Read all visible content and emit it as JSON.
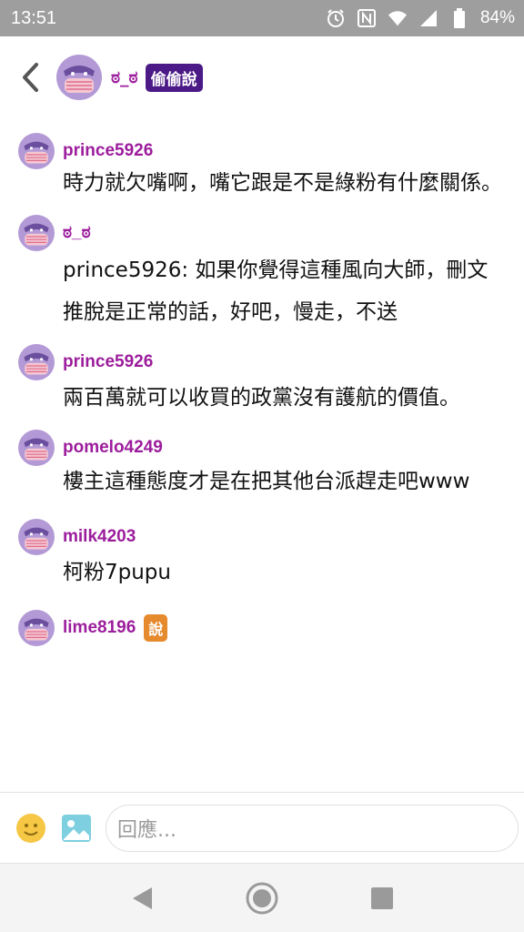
{
  "status_bar": {
    "time": "13:51",
    "battery": "84%",
    "icons": [
      "alarm-icon",
      "nfc-icon",
      "wifi-icon",
      "signal-icon",
      "battery-icon"
    ]
  },
  "header": {
    "title": "ಠ_ಠ",
    "badge": "偷偷說"
  },
  "comments": [
    {
      "user": "prince5926",
      "text": "時力就欠嘴啊，嘴它跟是不是綠粉有什麼關係。"
    },
    {
      "user": "ಠ_ಠ",
      "text": "prince5926: 如果你覺得這種風向大師，刪文推脫是正常的話，好吧，慢走，不送"
    },
    {
      "user": "prince5926",
      "text": "兩百萬就可以收買的政黨沒有護航的價值。"
    },
    {
      "user": "pomelo4249",
      "text": "樓主這種態度才是在把其他台派趕走吧www"
    },
    {
      "user": "milk4203",
      "text": "柯粉7pupu"
    },
    {
      "user": "lime8196",
      "badge": "說",
      "text": ""
    }
  ],
  "reply": {
    "placeholder": "回應..."
  },
  "colors": {
    "username": "#9c1d9c",
    "badge_purple": "#4b1a86",
    "badge_orange": "#e68a2e",
    "status_bar": "#9e9e9e"
  }
}
